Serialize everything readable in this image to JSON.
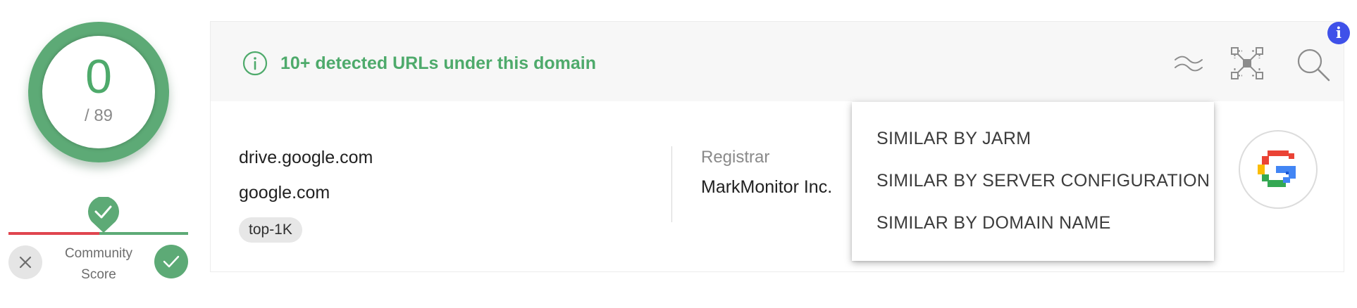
{
  "score": {
    "detections": "0",
    "total": "/ 89"
  },
  "community": {
    "label_line1": "Community",
    "label_line2": "Score"
  },
  "banner": {
    "text": "10+ detected URLs under this domain"
  },
  "toolbar": {
    "similar_icon": "wave-lines-icon",
    "graph_icon": "graph-icon",
    "search_icon": "search-icon"
  },
  "details": {
    "hosts": [
      "drive.google.com",
      "google.com"
    ],
    "tags": [
      "top-1K"
    ],
    "registrar_label": "Registrar",
    "registrar_value": "MarkMonitor Inc."
  },
  "similar_menu": {
    "items": [
      "SIMILAR BY JARM",
      "SIMILAR BY SERVER CONFIGURATION",
      "SIMILAR BY DOMAIN NAME"
    ]
  },
  "badge": {
    "text": "i"
  },
  "colors": {
    "accent_green": "#5daa76",
    "text_green": "#4eaa6b",
    "danger_red": "#e0454f",
    "badge_blue": "#3f51e9"
  }
}
